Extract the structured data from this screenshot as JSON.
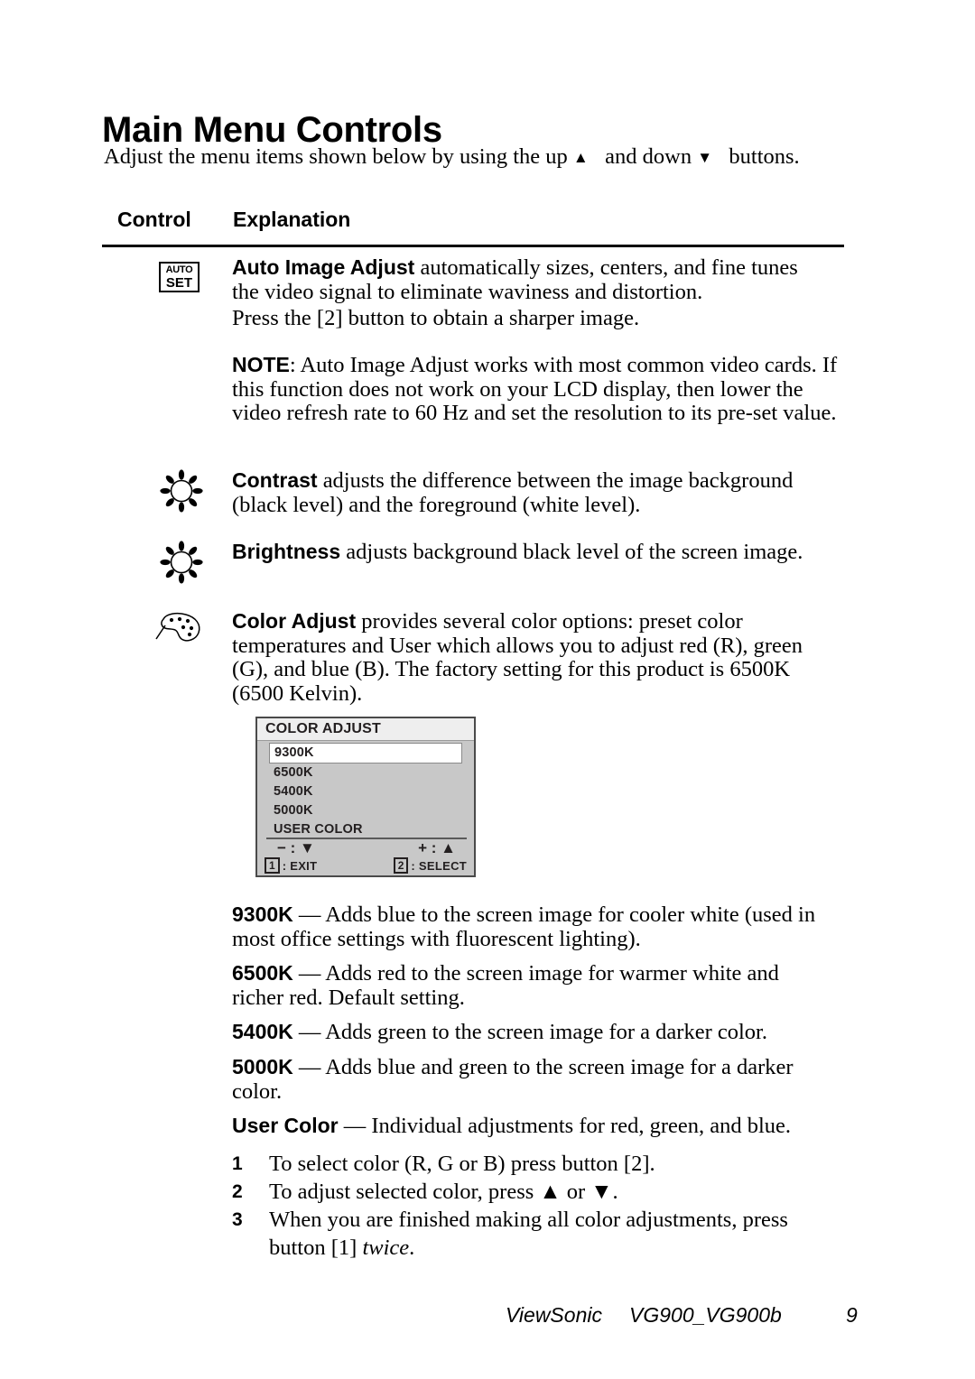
{
  "document": {
    "title": "Main Menu Controls",
    "intro_before": "Adjust the menu items shown below by using the up",
    "intro_middle": "and down",
    "intro_after": "buttons.",
    "columns": {
      "control": "Control",
      "explanation": "Explanation"
    }
  },
  "entries": {
    "auto_image_adjust": {
      "icon_line1": "AUTO",
      "icon_line2": "SET",
      "term": "Auto Image Adjust",
      "body": " automatically sizes, centers, and fine tunes the video signal to eliminate waviness and distortion.",
      "para2": "Press the [2] button to obtain a sharper image.",
      "note_label": "NOTE",
      "note_body": ": Auto Image Adjust works with most common video cards. If this function does not work on your LCD display, then lower the video refresh rate to 60 Hz and set the resolution to its pre-set value."
    },
    "contrast": {
      "icon": "sun-icon",
      "term": "Contrast",
      "body": " adjusts the difference between the image background (black level) and the foreground (white level)."
    },
    "brightness": {
      "icon": "sun-icon",
      "term": "Brightness",
      "body": " adjusts background black level of the screen image."
    },
    "color_adjust": {
      "icon": "palette-icon",
      "term": "Color Adjust",
      "body": " provides several color options: preset color temperatures and User which allows you to adjust red (R), green (G), and blue (B). The factory setting for this product is 6500K (6500 Kelvin)."
    }
  },
  "osd": {
    "title": "COLOR ADJUST",
    "items": [
      {
        "label": "9300K",
        "selected": true
      },
      {
        "label": "6500K",
        "selected": false
      },
      {
        "label": "5400K",
        "selected": false
      },
      {
        "label": "5000K",
        "selected": false
      },
      {
        "label": "USER COLOR",
        "selected": false
      }
    ],
    "symbol_left": "− : ▼",
    "symbol_right": "+ : ▲",
    "button_left_key": "1",
    "button_left_label": ": EXIT",
    "button_right_key": "2",
    "button_right_label": ": SELECT",
    "colors": {
      "background": "#c8c8c8",
      "title_bar": "#eeeeee",
      "selection": "#ffffff",
      "border": "#4a4a4a",
      "text": "#231f20"
    }
  },
  "temperatures": [
    {
      "term": "9300K",
      "dash": " — ",
      "body": "Adds blue to the screen image for cooler white (used in most office settings with fluorescent lighting)."
    },
    {
      "term": "6500K",
      "dash": " — ",
      "body": "Adds red to the screen image for warmer white and richer red. Default setting."
    },
    {
      "term": "5400K",
      "dash": " — ",
      "body": "Adds green to the screen image for a darker color."
    },
    {
      "term": "5000K",
      "dash": " — ",
      "body": "Adds blue and green to the screen image for a darker color."
    }
  ],
  "user_color": {
    "term": "User Color",
    "dash": " — ",
    "body": "Individual adjustments for red, green, and blue.",
    "steps": [
      {
        "num": "1",
        "text": "To select color (R, G or B) press button [2]."
      },
      {
        "num": "2",
        "text": "To adjust selected color, press ▲ or ▼."
      },
      {
        "num": "3",
        "text_before": "When you are finished making all color adjustments, press button [1] ",
        "text_italic": "twice",
        "text_after": "."
      }
    ]
  },
  "footer": {
    "brand": "ViewSonic",
    "model": "VG900_VG900b",
    "page_number": "9"
  }
}
